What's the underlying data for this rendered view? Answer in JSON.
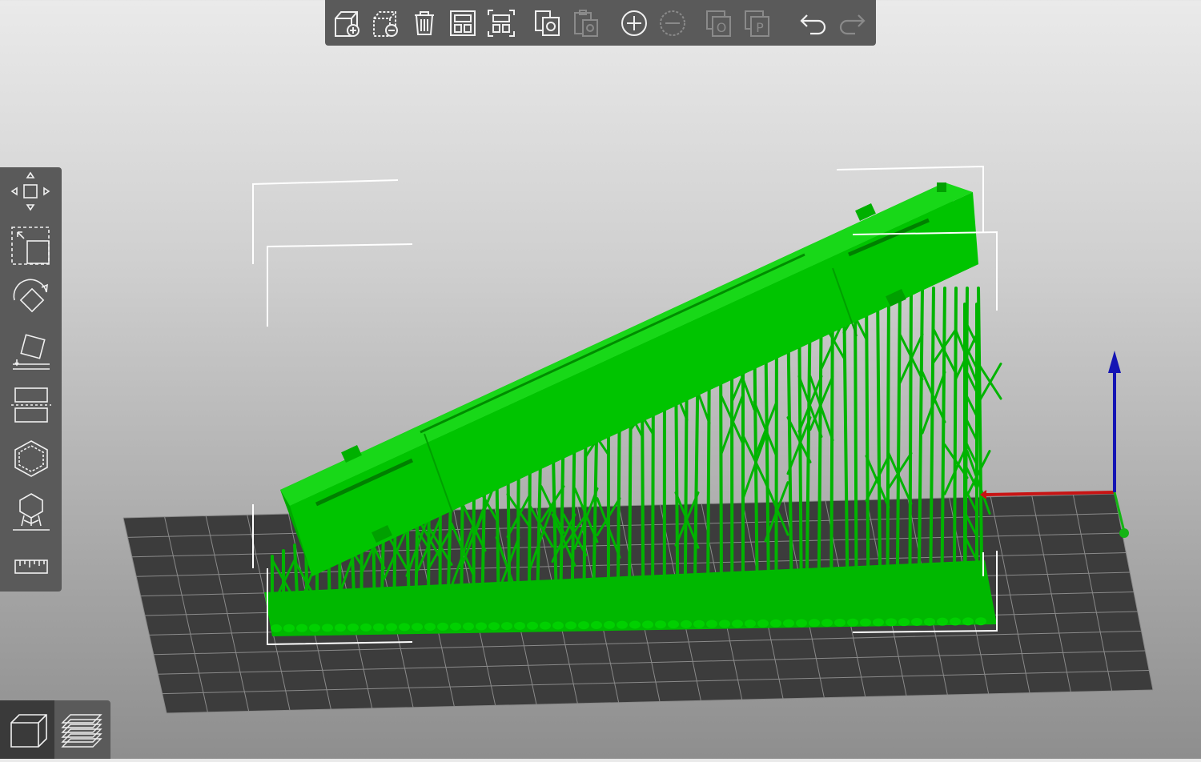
{
  "app": {
    "view": "3D scene"
  },
  "colors": {
    "model": "#00c800",
    "model_dark": "#00a000",
    "bed_grid": "#3c3c3c",
    "toolbar_bg": "#5a5a5a",
    "axis_x": "#c81414",
    "axis_z": "#1414b4",
    "axis_y": "#14b414"
  },
  "top_toolbar": {
    "buttons": [
      {
        "icon": "add-icon",
        "enabled": true
      },
      {
        "icon": "delete-icon",
        "enabled": true
      },
      {
        "icon": "delete-all-icon",
        "enabled": true
      },
      {
        "icon": "arrange-icon",
        "enabled": true
      },
      {
        "icon": "arrange-selection-icon",
        "enabled": true
      },
      {
        "icon": "copy-icon",
        "enabled": true
      },
      {
        "icon": "paste-icon",
        "enabled": false
      },
      {
        "icon": "add-instance-icon",
        "enabled": true
      },
      {
        "icon": "remove-instance-icon",
        "enabled": false
      },
      {
        "icon": "split-objects-icon",
        "enabled": false
      },
      {
        "icon": "split-parts-icon",
        "enabled": false
      },
      {
        "icon": "undo-icon",
        "enabled": true
      },
      {
        "icon": "redo-icon",
        "enabled": false
      }
    ],
    "split_objects_letter": "O",
    "split_parts_letter": "P"
  },
  "left_toolbar": {
    "buttons": [
      {
        "icon": "move-icon"
      },
      {
        "icon": "scale-icon"
      },
      {
        "icon": "rotate-icon"
      },
      {
        "icon": "place-on-face-icon"
      },
      {
        "icon": "cut-icon"
      },
      {
        "icon": "hollow-icon"
      },
      {
        "icon": "sla-supports-icon"
      },
      {
        "icon": "measure-icon"
      }
    ]
  },
  "view_switch": {
    "active": "3d-view",
    "buttons": [
      {
        "icon": "3d-view-icon"
      },
      {
        "icon": "preview-layers-icon"
      }
    ]
  }
}
